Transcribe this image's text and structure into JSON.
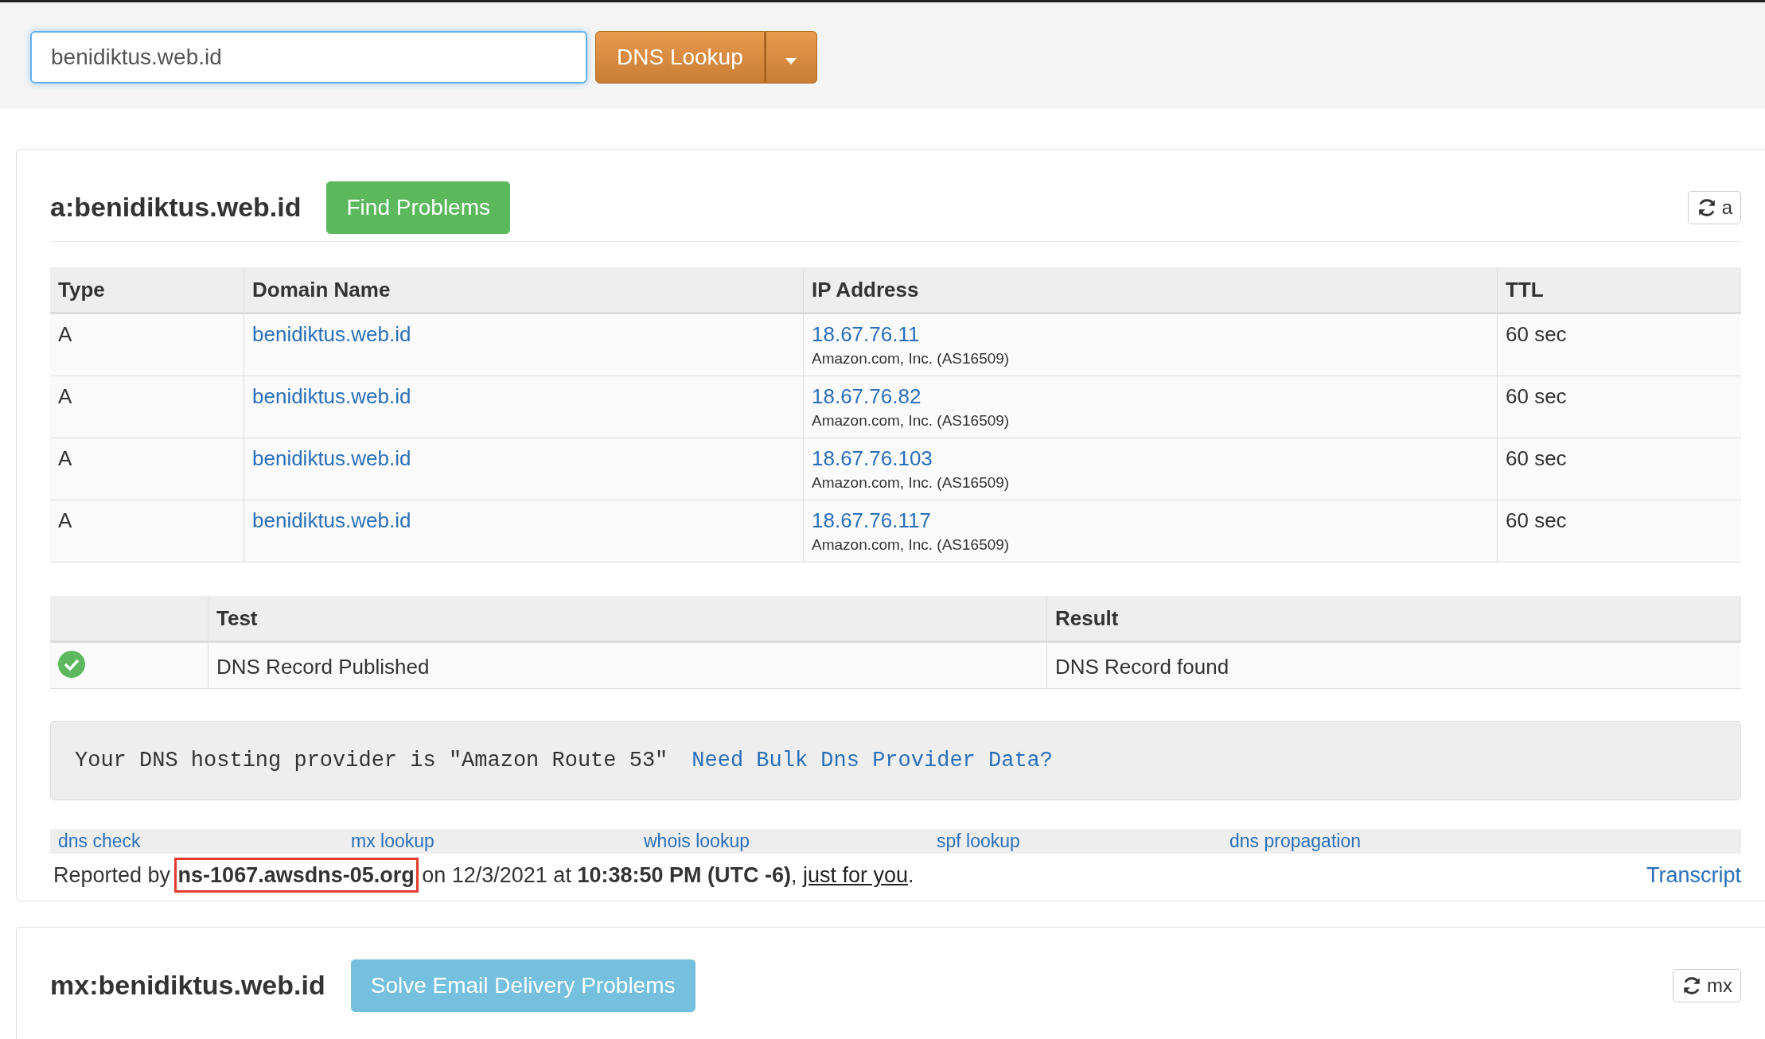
{
  "header": {
    "search": {
      "value": "benidiktus.web.id"
    },
    "lookup_button": "DNS Lookup"
  },
  "panels": [
    {
      "heading": "a:benidiktus.web.id",
      "action_button": "Find Problems",
      "color": "#5cb85c",
      "refresh_label": "a",
      "records": {
        "columns": [
          "Type",
          "Domain Name",
          "IP Address",
          "TTL"
        ],
        "rows": [
          {
            "type": "A",
            "domain": "benidiktus.web.id",
            "ip": "18.67.76.11",
            "owner": "Amazon.com, Inc. (AS16509)",
            "ttl": "60 sec"
          },
          {
            "type": "A",
            "domain": "benidiktus.web.id",
            "ip": "18.67.76.82",
            "owner": "Amazon.com, Inc. (AS16509)",
            "ttl": "60 sec"
          },
          {
            "type": "A",
            "domain": "benidiktus.web.id",
            "ip": "18.67.76.103",
            "owner": "Amazon.com, Inc. (AS16509)",
            "ttl": "60 sec"
          },
          {
            "type": "A",
            "domain": "benidiktus.web.id",
            "ip": "18.67.76.117",
            "owner": "Amazon.com, Inc. (AS16509)",
            "ttl": "60 sec"
          }
        ]
      },
      "tests": {
        "columns": [
          "Test",
          "Result"
        ],
        "rows": [
          {
            "passed": true,
            "test": "DNS Record Published",
            "result": "DNS Record found"
          }
        ]
      },
      "provider_note": "Your DNS hosting provider is \"Amazon Route 53\"",
      "provider_link": "Need Bulk Dns Provider Data?",
      "links": [
        "dns check",
        "mx lookup",
        "whois lookup",
        "spf lookup",
        "dns propagation"
      ],
      "report": {
        "prefix": "Reported by",
        "server": "ns-1067.awsdns-05.org",
        "middle": "on 12/3/2021 at",
        "time": "10:38:50 PM (UTC -6)",
        "after_time": ",",
        "link": "just for you",
        "end": ".",
        "server_highlighted": true
      },
      "transcript": "Transcript"
    },
    {
      "heading": "mx:benidiktus.web.id",
      "action_button": "Solve Email Delivery Problems",
      "color": "#74c0de",
      "refresh_label": "mx"
    }
  ]
}
